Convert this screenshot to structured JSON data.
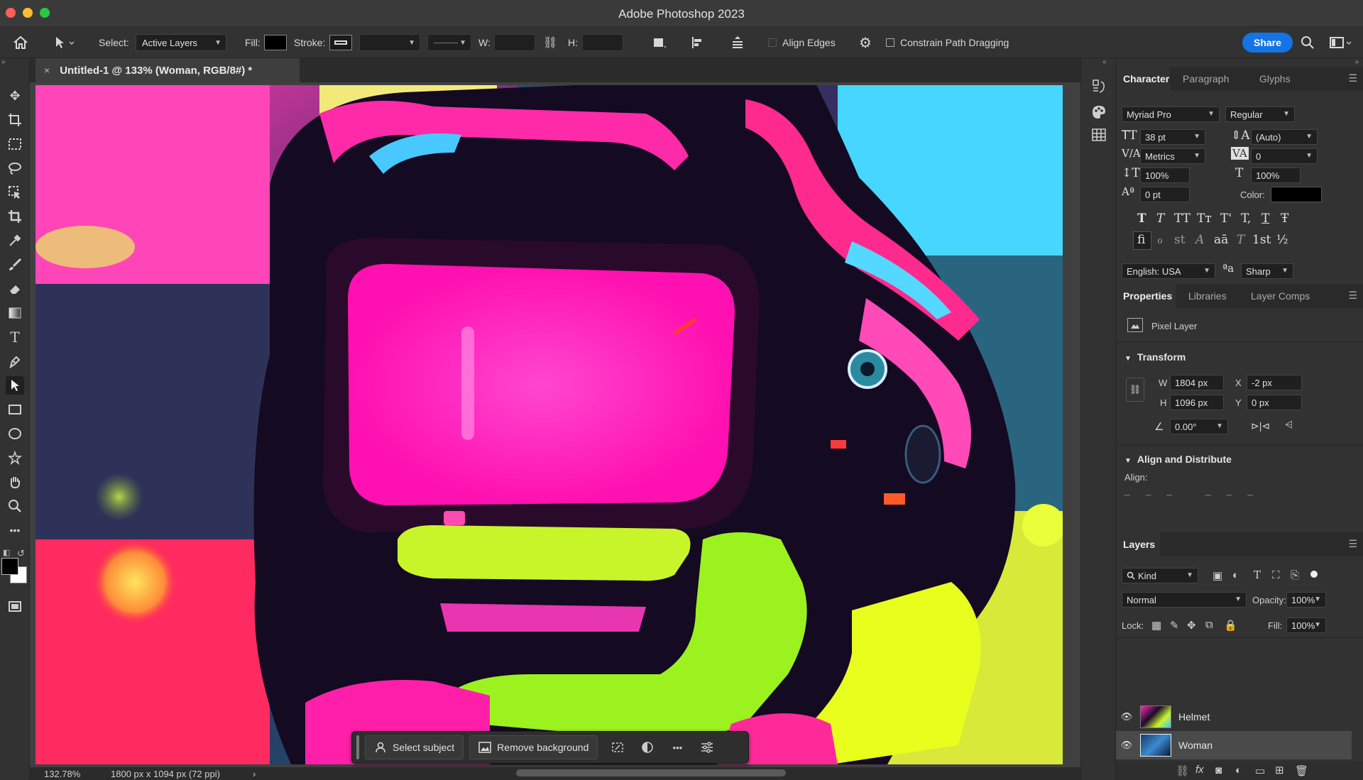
{
  "app": {
    "title": "Adobe Photoshop 2023"
  },
  "options": {
    "select_label": "Select:",
    "select_value": "Active Layers",
    "fill_label": "Fill:",
    "stroke_label": "Stroke:",
    "w_label": "W:",
    "h_label": "H:",
    "align_edges": "Align Edges",
    "constrain_path": "Constrain Path Dragging",
    "share": "Share"
  },
  "document": {
    "tab_title": "Untitled-1 @ 133% (Woman, RGB/8#) *",
    "close": "×",
    "zoom": "132.78%",
    "doc_info": "1800 px x 1094 px (72 ppi)",
    "status_arrow": "›"
  },
  "contextual_bar": {
    "select_subject": "Select subject",
    "remove_background": "Remove background",
    "more": "•••"
  },
  "character": {
    "tabs": [
      "Character",
      "Paragraph",
      "Glyphs"
    ],
    "font_family": "Myriad Pro",
    "font_style": "Regular",
    "font_size": "38 pt",
    "leading": "(Auto)",
    "kerning": "Metrics",
    "tracking": "0",
    "vscale": "100%",
    "hscale": "100%",
    "baseline": "0 pt",
    "color_label": "Color:",
    "language": "English: USA",
    "aa_label": "a",
    "antialias": "Sharp",
    "glyphs_row1": [
      "T",
      "T",
      "TT",
      "Tт",
      "T'",
      "T,",
      "T",
      "Ŧ"
    ],
    "glyphs_row2": [
      "fi",
      "ℴ",
      "st",
      "A",
      "aā",
      "T",
      "1st",
      "½"
    ]
  },
  "properties": {
    "tabs": [
      "Properties",
      "Libraries",
      "Layer Comps"
    ],
    "layer_type": "Pixel Layer",
    "transform_title": "Transform",
    "w_label": "W",
    "w": "1804 px",
    "h_label": "H",
    "h": "1096 px",
    "x_label": "X",
    "x": "-2 px",
    "y_label": "Y",
    "y": "0 px",
    "angle": "0.00°",
    "align_title": "Align and Distribute",
    "align_label": "Align:"
  },
  "layers": {
    "title": "Layers",
    "kind": "Kind",
    "blend_mode": "Normal",
    "opacity_label": "Opacity:",
    "opacity": "100%",
    "lock_label": "Lock:",
    "fill_label": "Fill:",
    "fill": "100%",
    "items": [
      {
        "name": "Helmet",
        "selected": false
      },
      {
        "name": "Woman",
        "selected": true
      }
    ]
  },
  "colors": {
    "accent": "#1473e6",
    "magenta": "#ff1fb4",
    "lime": "#c6ff1a",
    "cyan": "#3fd0ff"
  }
}
